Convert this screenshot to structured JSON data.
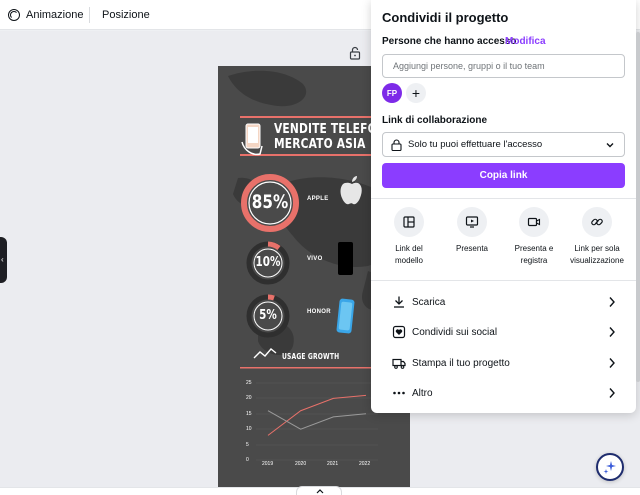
{
  "toolbar": {
    "animation_label": "Animazione",
    "position_label": "Posizione"
  },
  "poster": {
    "title_line1": "VENDITE TELEFONI",
    "title_line2": "MERCATO ASIA",
    "stats": [
      {
        "percent": "85%",
        "brand": "APPLE",
        "value": 85
      },
      {
        "percent": "10%",
        "brand": "VIVO",
        "value": 10
      },
      {
        "percent": "5%",
        "brand": "HONOR",
        "value": 5
      }
    ],
    "growth_title": "USAGE GROWTH",
    "accent_color": "#e8716a",
    "background_color": "#4a4a4a"
  },
  "chart_data": {
    "type": "line",
    "title": "USAGE GROWTH",
    "x": [
      "2019",
      "2020",
      "2021",
      "2022"
    ],
    "yticks": [
      "0",
      "5",
      "10",
      "15",
      "20",
      "25"
    ],
    "ylim": [
      0,
      25
    ],
    "series": [
      {
        "color": "#e8716a",
        "values": [
          8,
          16,
          20,
          21
        ]
      },
      {
        "color": "#9a9a9a",
        "values": [
          16,
          10,
          14,
          15
        ]
      }
    ]
  },
  "share_panel": {
    "title": "Condividi il progetto",
    "access_label": "Persone che hanno accesso",
    "modify_link": "Modifica",
    "people_placeholder": "Aggiungi persone, gruppi o il tuo team",
    "avatar_initials": "FP",
    "add_symbol": "+",
    "collab_label": "Link di collaborazione",
    "collab_value": "Solo tu puoi effettuare l'accesso",
    "copy_button": "Copia link",
    "options": [
      {
        "icon": "layout-template-icon",
        "line1": "Link del",
        "line2": "modello"
      },
      {
        "icon": "present-icon",
        "line1": "Presenta",
        "line2": ""
      },
      {
        "icon": "present-record-icon",
        "line1": "Presenta e",
        "line2": "registra"
      },
      {
        "icon": "view-only-link-icon",
        "line1": "Link per sola",
        "line2": "visualizzazione"
      }
    ],
    "rows": [
      {
        "icon": "download-icon",
        "label": "Scarica"
      },
      {
        "icon": "share-social-icon",
        "label": "Condividi sui social"
      },
      {
        "icon": "print-truck-icon",
        "label": "Stampa il tuo progetto"
      },
      {
        "icon": "more-dots-icon",
        "label": "Altro"
      }
    ],
    "accent_color": "#8b3dff"
  }
}
